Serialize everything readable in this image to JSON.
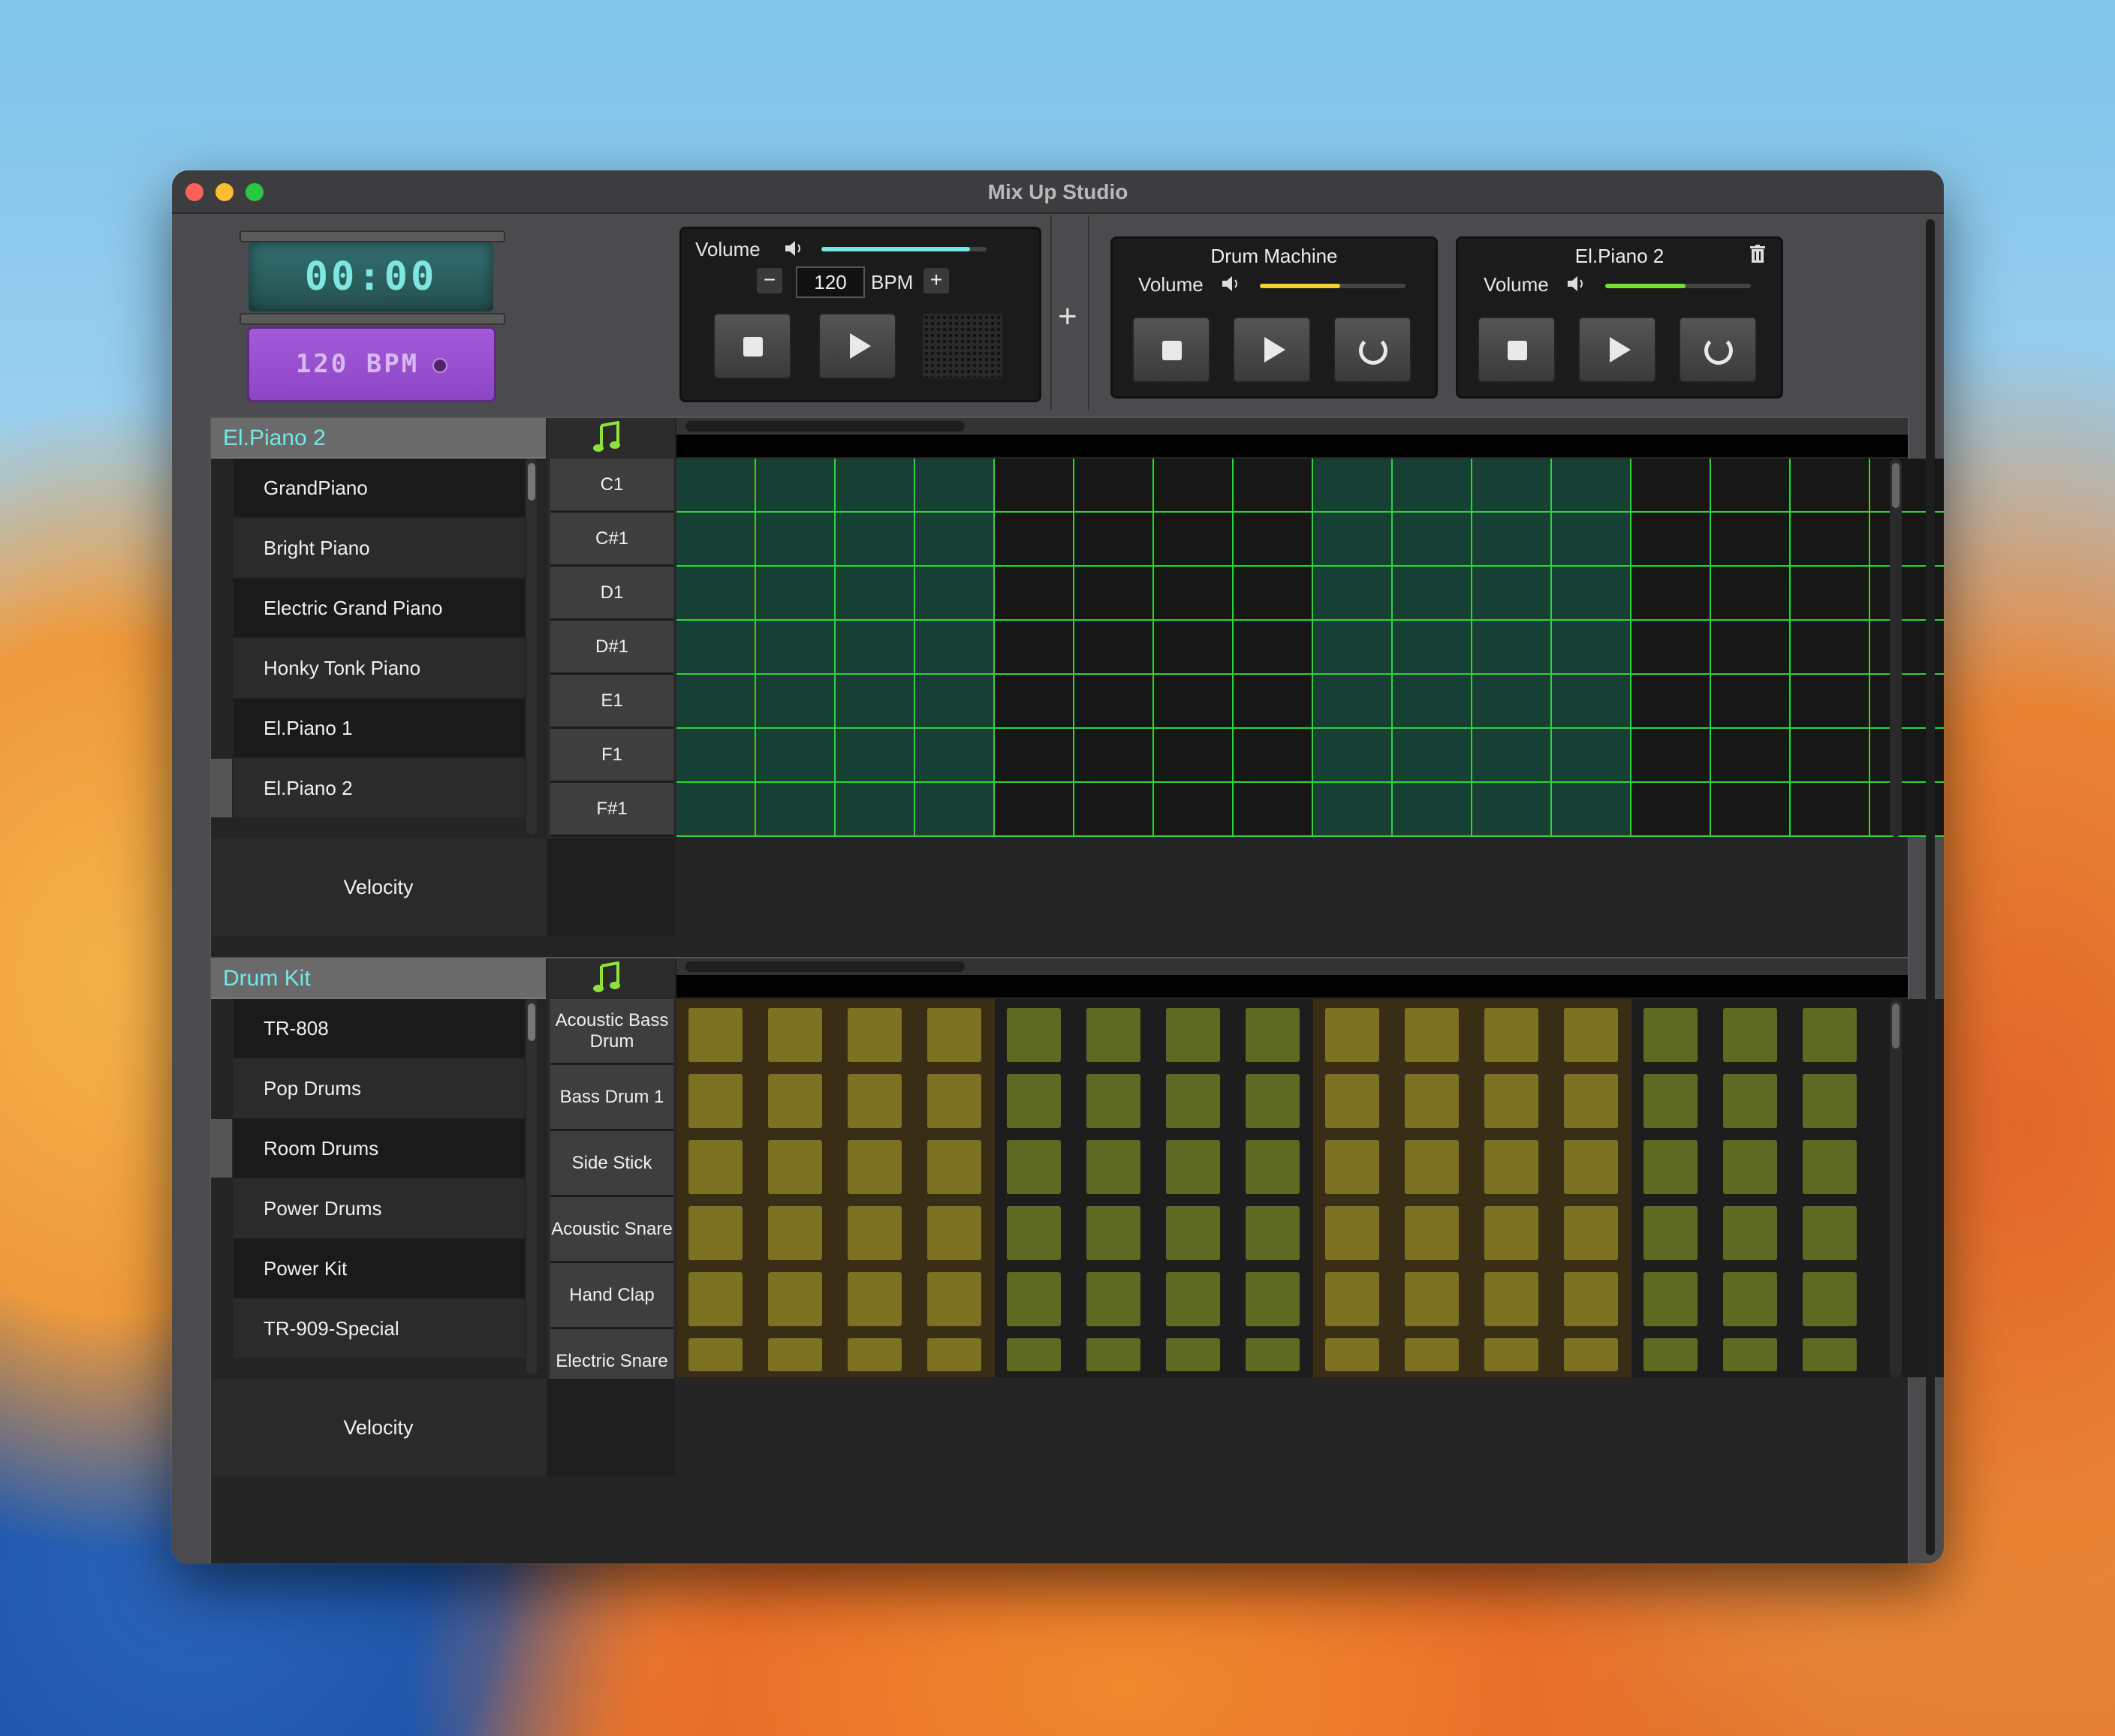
{
  "window": {
    "title": "Mix Up Studio"
  },
  "clock": {
    "time": "00:00"
  },
  "tempo_display": {
    "label": "120  BPM"
  },
  "transport": {
    "volume_label": "Volume",
    "volume_level": 0.9,
    "bpm_value": "120",
    "bpm_label": "BPM",
    "minus": "−",
    "plus": "+"
  },
  "add_track": "+",
  "tracks": [
    {
      "name": "Drum Machine",
      "volume_label": "Volume",
      "volume_level": 0.55,
      "volume_color": "#f2d321"
    },
    {
      "name": "El.Piano 2",
      "volume_label": "Volume",
      "volume_level": 0.55,
      "volume_color": "#6fe42a"
    }
  ],
  "piano_panel": {
    "title": "El.Piano 2",
    "instruments": [
      "GrandPiano",
      "Bright Piano",
      "Electric Grand Piano",
      "Honky Tonk Piano",
      "El.Piano 1",
      "El.Piano 2"
    ],
    "selected_index": 5,
    "notes": [
      "C1",
      "C#1",
      "D1",
      "D#1",
      "E1",
      "F1",
      "F#1"
    ],
    "velocity_label": "Velocity",
    "grid_color": "#2bd43a"
  },
  "drum_panel": {
    "title": "Drum Kit",
    "instruments": [
      "TR-808",
      "Pop Drums",
      "Room Drums",
      "Power Drums",
      "Power Kit",
      "TR-909-Special"
    ],
    "selected_index": 2,
    "sounds": [
      "Acoustic Bass Drum",
      "Bass Drum 1",
      "Side Stick",
      "Acoustic Snare",
      "Hand Clap",
      "Electric Snare"
    ],
    "velocity_label": "Velocity",
    "pad_color_bright": "#7b7323",
    "pad_color_dim": "#5e6a22"
  }
}
